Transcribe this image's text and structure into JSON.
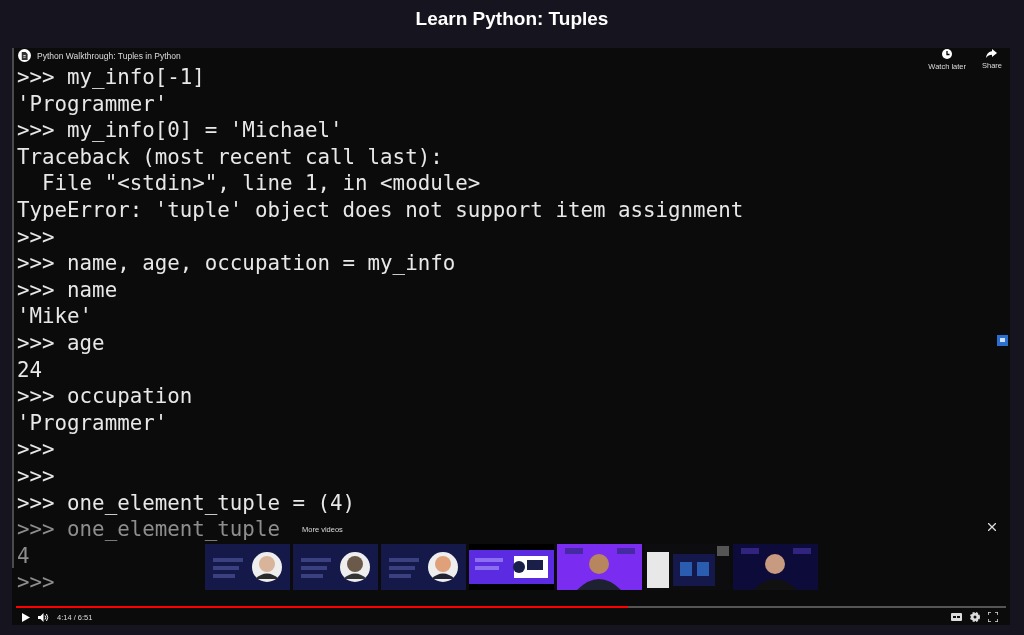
{
  "page": {
    "title": "Learn Python: Tuples"
  },
  "video": {
    "title": "Python Walkthrough: Tuples in Python",
    "actions": [
      {
        "kind": "clock",
        "label": "Watch later"
      },
      {
        "kind": "share",
        "label": "Share"
      }
    ],
    "terminal_lines": [
      {
        "text": ">>> my_info[-1]",
        "dimmed": false
      },
      {
        "text": "'Programmer'",
        "dimmed": false
      },
      {
        "text": ">>> my_info[0] = 'Michael'",
        "dimmed": false
      },
      {
        "text": "Traceback (most recent call last):",
        "dimmed": false
      },
      {
        "text": "  File \"<stdin>\", line 1, in <module>",
        "dimmed": false
      },
      {
        "text": "TypeError: 'tuple' object does not support item assignment",
        "dimmed": false
      },
      {
        "text": ">>>",
        "dimmed": false
      },
      {
        "text": ">>> name, age, occupation = my_info",
        "dimmed": false
      },
      {
        "text": ">>> name",
        "dimmed": false
      },
      {
        "text": "'Mike'",
        "dimmed": false
      },
      {
        "text": ">>> age",
        "dimmed": false
      },
      {
        "text": "24",
        "dimmed": false
      },
      {
        "text": ">>> occupation",
        "dimmed": false
      },
      {
        "text": "'Programmer'",
        "dimmed": false
      },
      {
        "text": ">>>",
        "dimmed": false
      },
      {
        "text": ">>>",
        "dimmed": false
      },
      {
        "text": ">>> one_element_tuple = (4)",
        "dimmed": false
      },
      {
        "text": ">>> one_element_tuple",
        "dimmed": true
      },
      {
        "text": "4",
        "dimmed": true
      },
      {
        "text": ">>>",
        "dimmed": true
      }
    ],
    "more_videos": {
      "label": "More videos"
    },
    "progress": {
      "level": 0.618
    },
    "time": "4:14 / 6:51"
  }
}
